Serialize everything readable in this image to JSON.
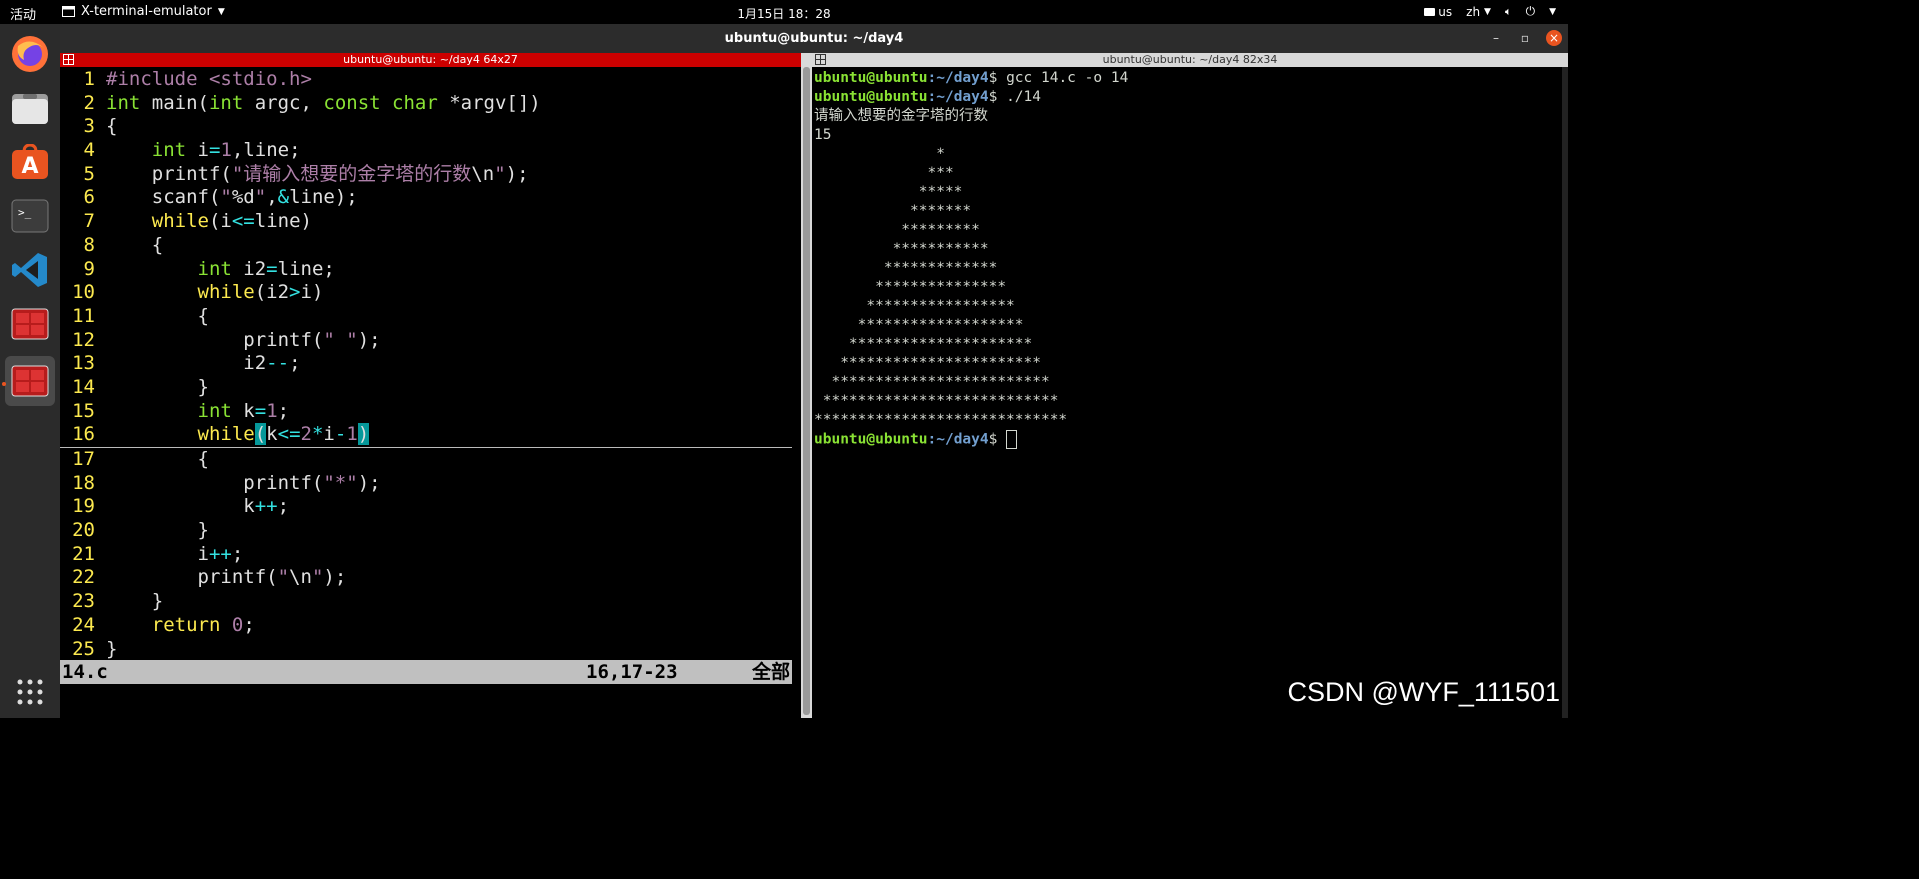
{
  "topbar": {
    "activities": "活动",
    "app_name": "X-terminal-emulator",
    "clock": "1月15日  18：28",
    "keyboard": "us",
    "input_method": "zh"
  },
  "dock": {
    "items": [
      {
        "name": "firefox-icon"
      },
      {
        "name": "files-icon"
      },
      {
        "name": "software-icon"
      },
      {
        "name": "terminal-icon"
      },
      {
        "name": "vscode-icon"
      },
      {
        "name": "terminator-icon"
      },
      {
        "name": "terminator-active-icon"
      }
    ]
  },
  "window": {
    "title": "ubuntu@ubuntu: ~/day4",
    "left_pane_title": "ubuntu@ubuntu: ~/day4 64x27",
    "right_pane_title": "ubuntu@ubuntu: ~/day4 82x34"
  },
  "editor": {
    "lines": [
      {
        "n": "1"
      },
      {
        "n": "2"
      },
      {
        "n": "3"
      },
      {
        "n": "4"
      },
      {
        "n": "5"
      },
      {
        "n": "6"
      },
      {
        "n": "7"
      },
      {
        "n": "8"
      },
      {
        "n": "9"
      },
      {
        "n": "10"
      },
      {
        "n": "11"
      },
      {
        "n": "12"
      },
      {
        "n": "13"
      },
      {
        "n": "14"
      },
      {
        "n": "15"
      },
      {
        "n": "16"
      },
      {
        "n": "17"
      },
      {
        "n": "18"
      },
      {
        "n": "19"
      },
      {
        "n": "20"
      },
      {
        "n": "21"
      },
      {
        "n": "22"
      },
      {
        "n": "23"
      },
      {
        "n": "24"
      },
      {
        "n": "25"
      }
    ],
    "tokens": {
      "l1_pp": "#include ",
      "l1_hdr": "<stdio.h>",
      "l2_int": "int",
      "l2_rest1": " main(",
      "l2_int2": "int",
      "l2_rest2": " argc, ",
      "l2_const": "const",
      "l2_sp": " ",
      "l2_char": "char",
      "l2_rest3": " *argv[])",
      "l3": "{",
      "l4_int": "int",
      "l4_a": " i",
      "l4_eq": "=",
      "l4_one": "1",
      "l4_b": ",line;",
      "l5_a": "printf(",
      "l5_str": "\"请输入想要的金字塔的行数",
      "l5_esc": "\\n",
      "l5_q": "\"",
      "l5_b": ");",
      "l6_a": "scanf(",
      "l6_q1": "\"",
      "l6_fmt": "%d",
      "l6_q2": "\"",
      "l6_b": ",",
      "l6_amp": "&",
      "l6_c": "line);",
      "l7_kw": "while",
      "l7_a": "(i",
      "l7_op": "<=",
      "l7_b": "line)",
      "l8": "{",
      "l9_int": "int",
      "l9_a": " i2",
      "l9_op": "=",
      "l9_b": "line;",
      "l10_kw": "while",
      "l10_a": "(i2",
      "l10_op": ">",
      "l10_b": "i)",
      "l11": "{",
      "l12_a": "printf(",
      "l12_str": "\" \"",
      "l12_b": ");",
      "l13_a": "i2",
      "l13_op": "--",
      "l13_b": ";",
      "l14": "}",
      "l15_int": "int",
      "l15_a": " k",
      "l15_op": "=",
      "l15_num": "1",
      "l15_b": ";",
      "l16_kw": "while",
      "l16_p1": "(",
      "l16_a": "k",
      "l16_op1": "<=",
      "l16_num1": "2",
      "l16_op2": "*",
      "l16_b": "i",
      "l16_op3": "-",
      "l16_num2": "1",
      "l16_p2": ")",
      "l17": "{",
      "l18_a": "printf(",
      "l18_str": "\"*\"",
      "l18_b": ");",
      "l19_a": "k",
      "l19_op": "++",
      "l19_b": ";",
      "l20": "}",
      "l21_a": "i",
      "l21_op": "++",
      "l21_b": ";",
      "l22_a": "printf(",
      "l22_q1": "\"",
      "l22_esc": "\\n",
      "l22_q2": "\"",
      "l22_b": ");",
      "l23": "}",
      "l24_kw": "return",
      "l24_sp": " ",
      "l24_num": "0",
      "l24_b": ";",
      "l25": "}"
    },
    "status": {
      "filename": "14.c",
      "position": "16,17-23",
      "scroll": "全部"
    }
  },
  "terminal": {
    "prompt_user": "ubuntu@ubuntu",
    "prompt_dir": ":~/day4",
    "prompt_sym": "$ ",
    "cmd1": "gcc 14.c -o 14",
    "cmd2": "./14",
    "output_prompt": "请输入想要的金字塔的行数",
    "input_value": "15",
    "pyramid": [
      "              *",
      "             ***",
      "            *****",
      "           *******",
      "          *********",
      "         ***********",
      "        *************",
      "       ***************",
      "      *****************",
      "     *******************",
      "    *********************",
      "   ***********************",
      "  *************************",
      " ***************************",
      "*****************************"
    ]
  },
  "watermark": "CSDN @WYF_111501"
}
